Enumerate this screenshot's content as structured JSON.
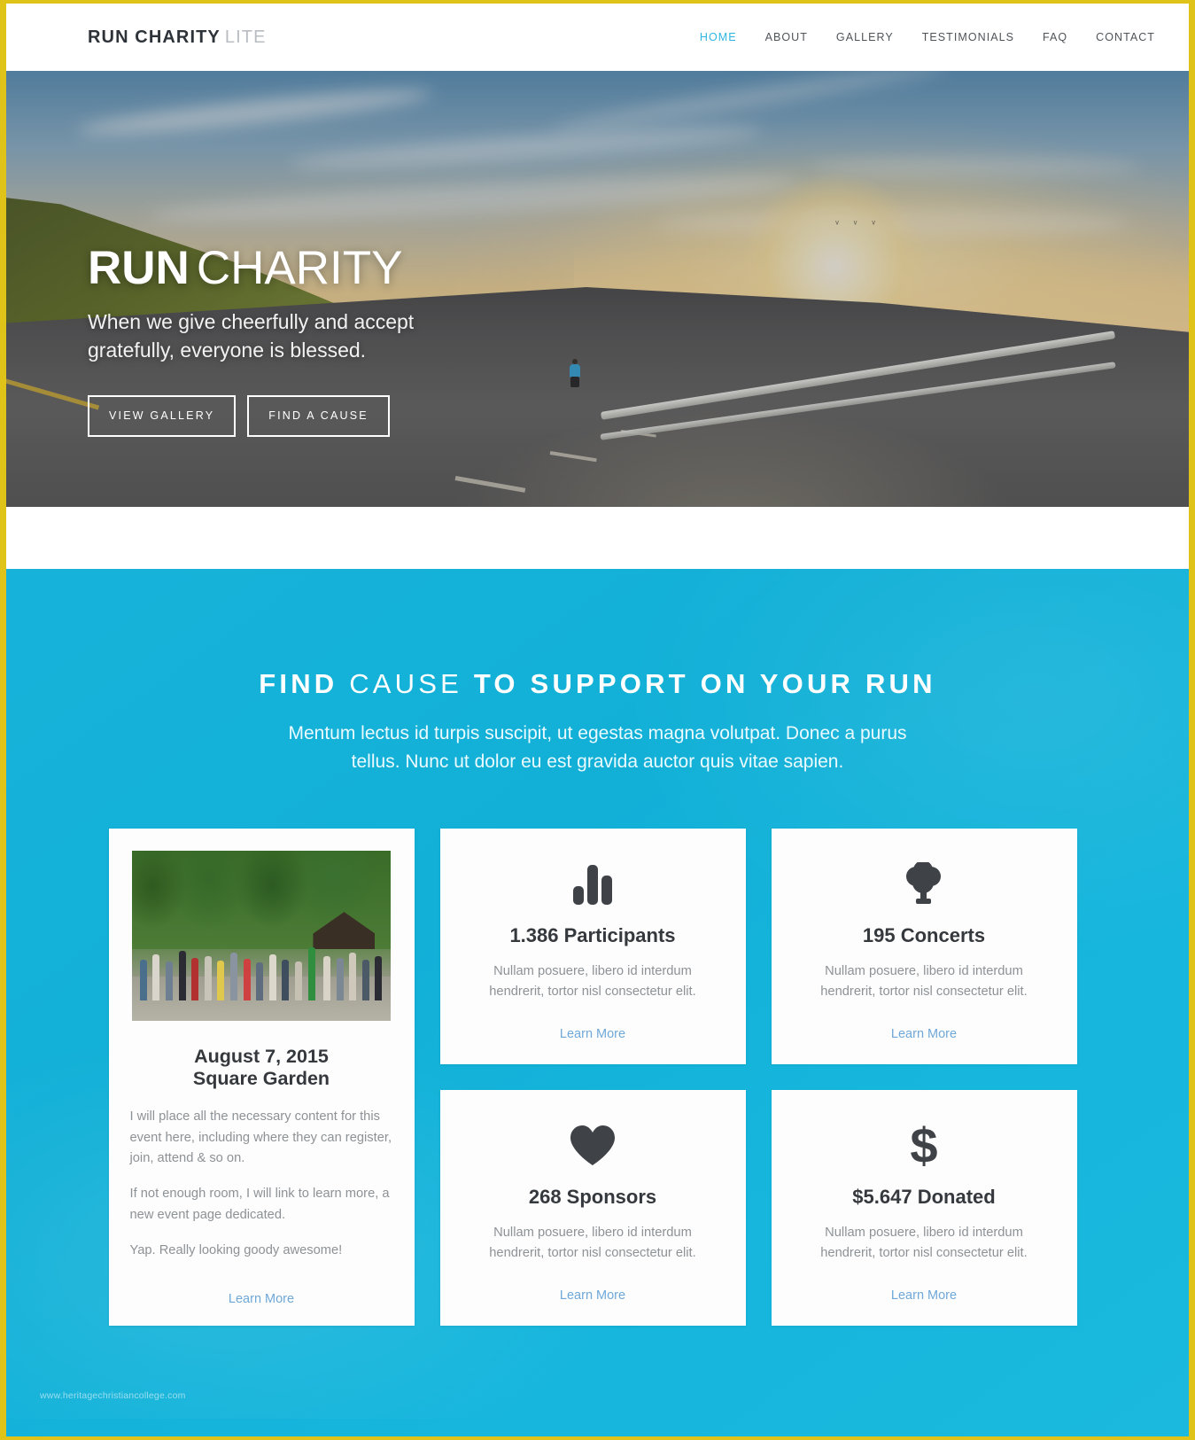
{
  "header": {
    "logo_strong": "RUN CHARITY",
    "logo_light": "LITE",
    "nav": [
      {
        "label": "HOME",
        "active": true
      },
      {
        "label": "ABOUT",
        "active": false
      },
      {
        "label": "GALLERY",
        "active": false
      },
      {
        "label": "TESTIMONIALS",
        "active": false
      },
      {
        "label": "FAQ",
        "active": false
      },
      {
        "label": "CONTACT",
        "active": false
      }
    ]
  },
  "hero": {
    "title_strong": "RUN",
    "title_light": "CHARITY",
    "subtitle": "When we give cheerfully and accept gratefully, everyone is blessed.",
    "button_gallery": "VIEW GALLERY",
    "button_cause": "FIND A CAUSE"
  },
  "causes": {
    "title_strong_1": "FIND",
    "title_light": "CAUSE",
    "title_strong_2": "TO SUPPORT ON YOUR RUN",
    "subtitle": "Mentum lectus id turpis suscipit, ut egestas magna volutpat. Donec a purus tellus. Nunc ut dolor eu est gravida auctor quis vitae sapien.",
    "event": {
      "date": "August 7, 2015",
      "venue": "Square Garden",
      "paragraph_1": "I will place all the necessary content for this event here, including where they can register, join, attend & so on.",
      "paragraph_2": "If not enough room, I will link to learn more, a new event page dedicated.",
      "paragraph_3": "Yap. Really looking goody awesome!",
      "learn_more": "Learn More",
      "image_alt": "crowd-of-runners-photo"
    },
    "stats": [
      {
        "icon": "bar-chart-icon",
        "title": "1.386 Participants",
        "description": "Nullam posuere, libero id interdum hendrerit, tortor nisl consectetur elit.",
        "learn_more": "Learn More"
      },
      {
        "icon": "tree-icon",
        "title": "195 Concerts",
        "description": "Nullam posuere, libero id interdum hendrerit, tortor nisl consectetur elit.",
        "learn_more": "Learn More"
      },
      {
        "icon": "heart-icon",
        "title": "268 Sponsors",
        "description": "Nullam posuere, libero id interdum hendrerit, tortor nisl consectetur elit.",
        "learn_more": "Learn More"
      },
      {
        "icon": "dollar-icon",
        "title": "$5.647 Donated",
        "description": "Nullam posuere, libero id interdum hendrerit, tortor nisl consectetur elit.",
        "learn_more": "Learn More"
      }
    ]
  },
  "watermark": "www.heritagechristiancollege.com",
  "colors": {
    "accent_cyan": "#12b0d7",
    "nav_active": "#2fb6e0",
    "link_blue": "#6fa8d8",
    "border_gold": "#e0c318",
    "heading_dark": "#35393d",
    "body_gray": "#8d9296"
  }
}
